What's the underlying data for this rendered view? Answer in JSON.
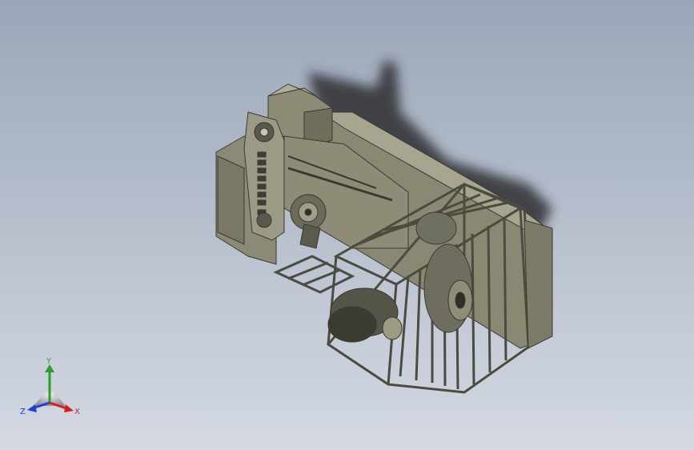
{
  "viewport": {
    "background_top": "#9aa6b8",
    "background_bottom": "#d4d9e2"
  },
  "model": {
    "body_color": "#8f8d78",
    "dark_color": "#4a493e",
    "light_color": "#b5b39d"
  },
  "triad": {
    "x_label": "X",
    "y_label": "Y",
    "z_label": "Z",
    "x_color": "#d22020",
    "y_color": "#2aa02a",
    "z_color": "#2040d0"
  }
}
